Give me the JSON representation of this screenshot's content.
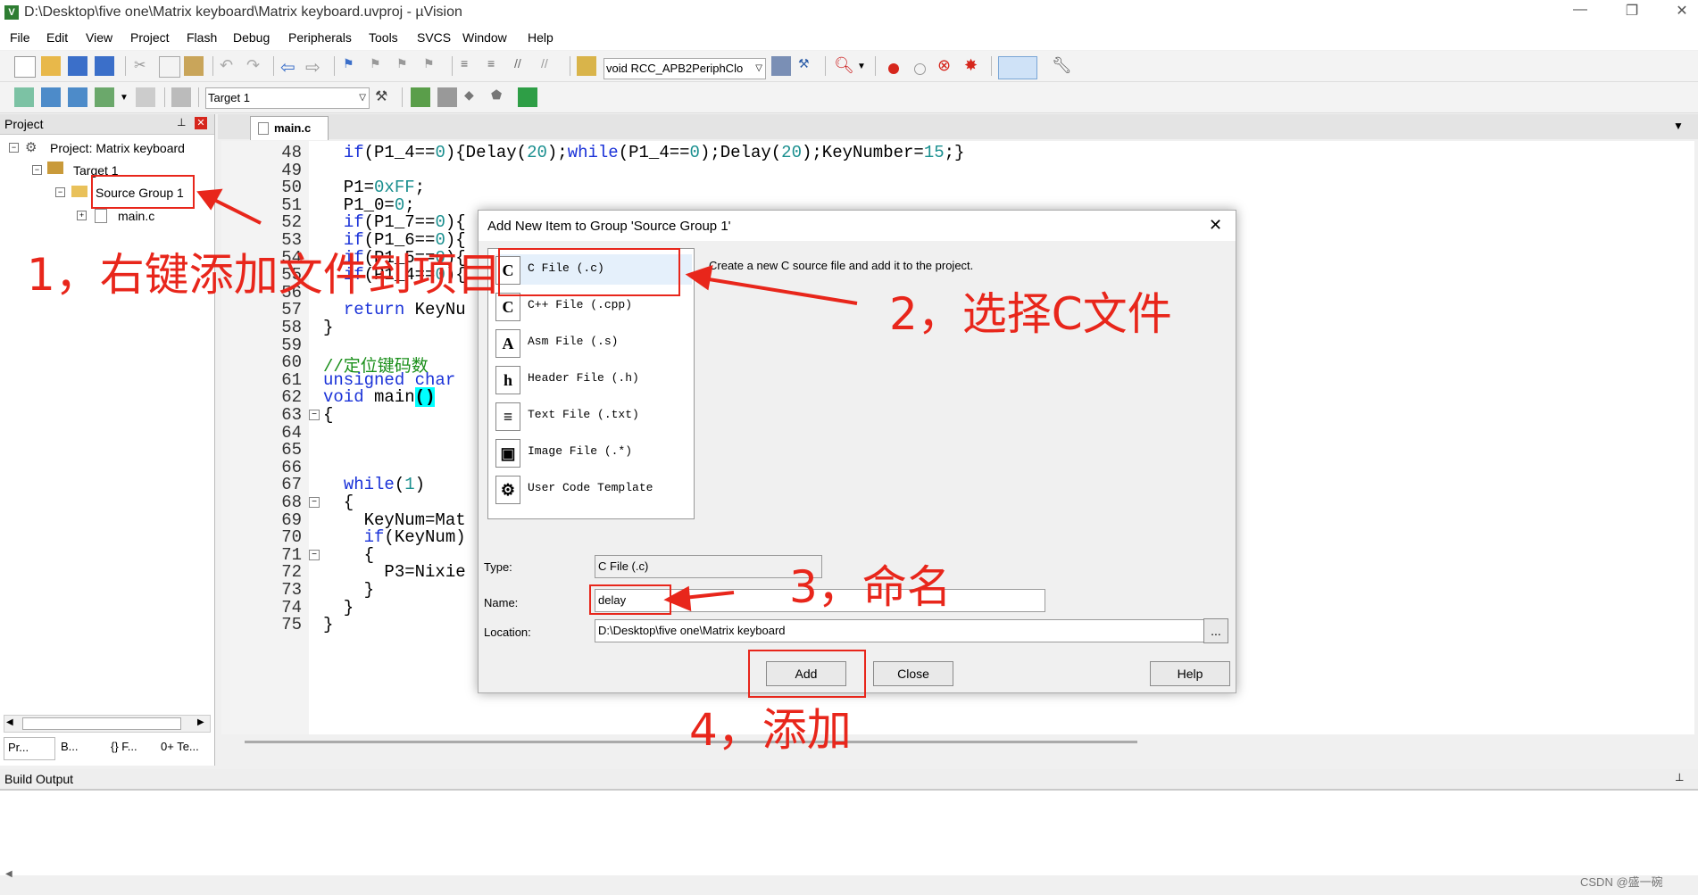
{
  "window": {
    "title": "D:\\Desktop\\five one\\Matrix keyboard\\Matrix keyboard.uvproj - µVision",
    "app_icon": "V"
  },
  "menu": [
    "File",
    "Edit",
    "View",
    "Project",
    "Flash",
    "Debug",
    "Peripherals",
    "Tools",
    "SVCS",
    "Window",
    "Help"
  ],
  "toolbar1": {
    "function_combo": "void RCC_APB2PeriphClo"
  },
  "toolbar2": {
    "target_combo": "Target 1"
  },
  "project_panel": {
    "title": "Project",
    "root": "Project: Matrix keyboard",
    "target": "Target 1",
    "group": "Source Group 1",
    "file": "main.c",
    "bottom_tabs": [
      "Pr...",
      "B...",
      "{} F...",
      "0+ Te..."
    ]
  },
  "editor": {
    "tab": "main.c",
    "lines": [
      {
        "n": "48",
        "code": "  if(P1_4==0){Delay(20);while(P1_4==0);Delay(20);KeyNumber=15;}"
      },
      {
        "n": "49",
        "code": ""
      },
      {
        "n": "50",
        "code": "  P1=0xFF;"
      },
      {
        "n": "51",
        "code": "  P1_0=0;"
      },
      {
        "n": "52",
        "code": "  if(P1_7==0){"
      },
      {
        "n": "53",
        "code": "  if(P1_6==0){"
      },
      {
        "n": "54",
        "code": "  if(P1_5==0){"
      },
      {
        "n": "55",
        "code": "  if(P1_4==0){"
      },
      {
        "n": "56",
        "code": ""
      },
      {
        "n": "57",
        "code": "  return KeyNu"
      },
      {
        "n": "58",
        "code": "}"
      },
      {
        "n": "59",
        "code": ""
      },
      {
        "n": "60",
        "code": "//定位键码数"
      },
      {
        "n": "61",
        "code": "unsigned char"
      },
      {
        "n": "62",
        "code": "void main()"
      },
      {
        "n": "63",
        "code": "{"
      },
      {
        "n": "64",
        "code": ""
      },
      {
        "n": "65",
        "code": ""
      },
      {
        "n": "66",
        "code": ""
      },
      {
        "n": "67",
        "code": "  while(1)"
      },
      {
        "n": "68",
        "code": "  {"
      },
      {
        "n": "69",
        "code": "    KeyNum=Mat"
      },
      {
        "n": "70",
        "code": "    if(KeyNum)"
      },
      {
        "n": "71",
        "code": "    {"
      },
      {
        "n": "72",
        "code": "      P3=Nixie"
      },
      {
        "n": "73",
        "code": "    }"
      },
      {
        "n": "74",
        "code": "  }"
      },
      {
        "n": "75",
        "code": "}"
      }
    ]
  },
  "dialog": {
    "title": "Add New Item to Group 'Source Group 1'",
    "description": "Create a new C source file and add it to the project.",
    "types": [
      {
        "icon": "C",
        "label": "C File (.c)"
      },
      {
        "icon": "C",
        "label": "C++ File (.cpp)"
      },
      {
        "icon": "A",
        "label": "Asm File (.s)"
      },
      {
        "icon": "h",
        "label": "Header File (.h)"
      },
      {
        "icon": "≡",
        "label": "Text File (.txt)"
      },
      {
        "icon": "▣",
        "label": "Image File (.*)"
      },
      {
        "icon": "⚙",
        "label": "User Code Template"
      }
    ],
    "type_label": "Type:",
    "type_value": "C File (.c)",
    "name_label": "Name:",
    "name_value": "delay",
    "location_label": "Location:",
    "location_value": "D:\\Desktop\\five one\\Matrix keyboard",
    "browse": "...",
    "add": "Add",
    "close": "Close",
    "help": "Help"
  },
  "annotations": {
    "step1": "1，右键添加文件到项目",
    "step2": "2，选择C文件",
    "step3": "3，命名",
    "step4": "4，添加"
  },
  "build_output": {
    "title": "Build Output"
  },
  "watermark": "CSDN @盛一碗"
}
